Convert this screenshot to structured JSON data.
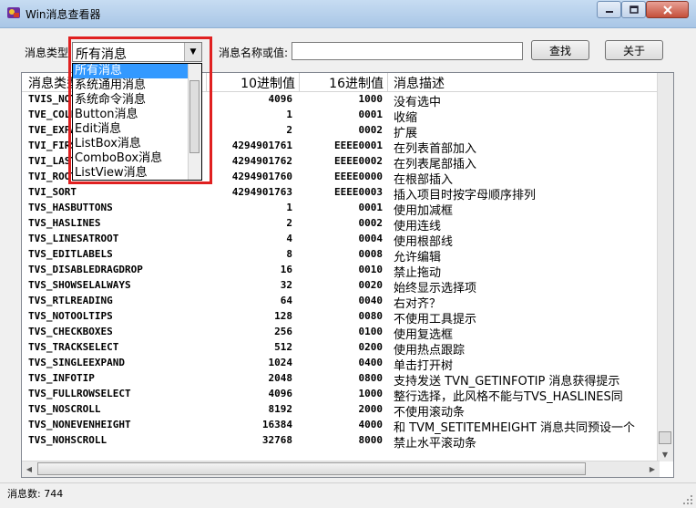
{
  "window": {
    "title": "Win消息查看器"
  },
  "toolbar": {
    "type_label": "消息类型:",
    "combo_value": "所有消息",
    "name_label": "消息名称或值:",
    "search_value": "",
    "search_button": "查找",
    "about_button": "关于"
  },
  "dropdown": {
    "options": [
      "所有消息",
      "系统通用消息",
      "系统命令消息",
      "Button消息",
      "Edit消息",
      "ListBox消息",
      "ComboBox消息",
      "ListView消息"
    ]
  },
  "list": {
    "headers": [
      "消息类型",
      "10进制值",
      "16进制值",
      "消息描述"
    ],
    "rows": [
      {
        "name": "TVIS_NOTSELECT",
        "dec": "4096",
        "hex": "1000",
        "desc": "没有选中"
      },
      {
        "name": "TVE_COLLAPSE",
        "dec": "1",
        "hex": "0001",
        "desc": "收缩"
      },
      {
        "name": "TVE_EXPAND",
        "dec": "2",
        "hex": "0002",
        "desc": "扩展"
      },
      {
        "name": "TVI_FIRST",
        "dec": "4294901761",
        "hex": "EEEE0001",
        "desc": "在列表首部加入"
      },
      {
        "name": "TVI_LAST",
        "dec": "4294901762",
        "hex": "EEEE0002",
        "desc": "在列表尾部插入"
      },
      {
        "name": "TVI_ROOT",
        "dec": "4294901760",
        "hex": "EEEE0000",
        "desc": "在根部插入"
      },
      {
        "name": "TVI_SORT",
        "dec": "4294901763",
        "hex": "EEEE0003",
        "desc": "插入项目时按字母顺序排列"
      },
      {
        "name": "TVS_HASBUTTONS",
        "dec": "1",
        "hex": "0001",
        "desc": "使用加减框"
      },
      {
        "name": "TVS_HASLINES",
        "dec": "2",
        "hex": "0002",
        "desc": "使用连线"
      },
      {
        "name": "TVS_LINESATROOT",
        "dec": "4",
        "hex": "0004",
        "desc": "使用根部线"
      },
      {
        "name": "TVS_EDITLABELS",
        "dec": "8",
        "hex": "0008",
        "desc": "允许编辑"
      },
      {
        "name": "TVS_DISABLEDRAGDROP",
        "dec": "16",
        "hex": "0010",
        "desc": "禁止拖动"
      },
      {
        "name": "TVS_SHOWSELALWAYS",
        "dec": "32",
        "hex": "0020",
        "desc": "始终显示选择项"
      },
      {
        "name": "TVS_RTLREADING",
        "dec": "64",
        "hex": "0040",
        "desc": "右对齐？"
      },
      {
        "name": "TVS_NOTOOLTIPS",
        "dec": "128",
        "hex": "0080",
        "desc": "不使用工具提示"
      },
      {
        "name": "TVS_CHECKBOXES",
        "dec": "256",
        "hex": "0100",
        "desc": "使用复选框"
      },
      {
        "name": "TVS_TRACKSELECT",
        "dec": "512",
        "hex": "0200",
        "desc": "使用热点跟踪"
      },
      {
        "name": "TVS_SINGLEEXPAND",
        "dec": "1024",
        "hex": "0400",
        "desc": "单击打开树"
      },
      {
        "name": "TVS_INFOTIP",
        "dec": "2048",
        "hex": "0800",
        "desc": "支持发送 TVN_GETINFOTIP 消息获得提示"
      },
      {
        "name": "TVS_FULLROWSELECT",
        "dec": "4096",
        "hex": "1000",
        "desc": "整行选择，此风格不能与TVS_HASLINES同"
      },
      {
        "name": "TVS_NOSCROLL",
        "dec": "8192",
        "hex": "2000",
        "desc": "不使用滚动条"
      },
      {
        "name": "TVS_NONEVENHEIGHT",
        "dec": "16384",
        "hex": "4000",
        "desc": "和 TVM_SETITEMHEIGHT 消息共同预设一个"
      },
      {
        "name": "TVS_NOHSCROLL",
        "dec": "32768",
        "hex": "8000",
        "desc": "禁止水平滚动条"
      }
    ]
  },
  "status": {
    "text": "消息数: 744"
  },
  "colors": {
    "highlight": "#e02020",
    "selection": "#3399ff"
  }
}
